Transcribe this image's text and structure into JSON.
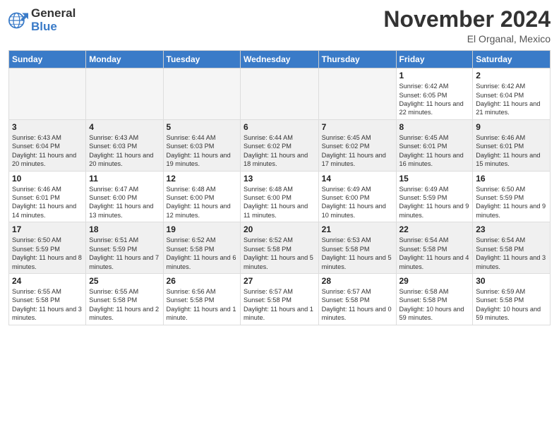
{
  "header": {
    "logo_general": "General",
    "logo_blue": "Blue",
    "month_title": "November 2024",
    "location": "El Organal, Mexico"
  },
  "days_of_week": [
    "Sunday",
    "Monday",
    "Tuesday",
    "Wednesday",
    "Thursday",
    "Friday",
    "Saturday"
  ],
  "weeks": [
    [
      {
        "day": "",
        "empty": true
      },
      {
        "day": "",
        "empty": true
      },
      {
        "day": "",
        "empty": true
      },
      {
        "day": "",
        "empty": true
      },
      {
        "day": "",
        "empty": true
      },
      {
        "day": "1",
        "sunrise": "Sunrise: 6:42 AM",
        "sunset": "Sunset: 6:05 PM",
        "daylight": "Daylight: 11 hours and 22 minutes."
      },
      {
        "day": "2",
        "sunrise": "Sunrise: 6:42 AM",
        "sunset": "Sunset: 6:04 PM",
        "daylight": "Daylight: 11 hours and 21 minutes."
      }
    ],
    [
      {
        "day": "3",
        "sunrise": "Sunrise: 6:43 AM",
        "sunset": "Sunset: 6:04 PM",
        "daylight": "Daylight: 11 hours and 20 minutes."
      },
      {
        "day": "4",
        "sunrise": "Sunrise: 6:43 AM",
        "sunset": "Sunset: 6:03 PM",
        "daylight": "Daylight: 11 hours and 20 minutes."
      },
      {
        "day": "5",
        "sunrise": "Sunrise: 6:44 AM",
        "sunset": "Sunset: 6:03 PM",
        "daylight": "Daylight: 11 hours and 19 minutes."
      },
      {
        "day": "6",
        "sunrise": "Sunrise: 6:44 AM",
        "sunset": "Sunset: 6:02 PM",
        "daylight": "Daylight: 11 hours and 18 minutes."
      },
      {
        "day": "7",
        "sunrise": "Sunrise: 6:45 AM",
        "sunset": "Sunset: 6:02 PM",
        "daylight": "Daylight: 11 hours and 17 minutes."
      },
      {
        "day": "8",
        "sunrise": "Sunrise: 6:45 AM",
        "sunset": "Sunset: 6:01 PM",
        "daylight": "Daylight: 11 hours and 16 minutes."
      },
      {
        "day": "9",
        "sunrise": "Sunrise: 6:46 AM",
        "sunset": "Sunset: 6:01 PM",
        "daylight": "Daylight: 11 hours and 15 minutes."
      }
    ],
    [
      {
        "day": "10",
        "sunrise": "Sunrise: 6:46 AM",
        "sunset": "Sunset: 6:01 PM",
        "daylight": "Daylight: 11 hours and 14 minutes."
      },
      {
        "day": "11",
        "sunrise": "Sunrise: 6:47 AM",
        "sunset": "Sunset: 6:00 PM",
        "daylight": "Daylight: 11 hours and 13 minutes."
      },
      {
        "day": "12",
        "sunrise": "Sunrise: 6:48 AM",
        "sunset": "Sunset: 6:00 PM",
        "daylight": "Daylight: 11 hours and 12 minutes."
      },
      {
        "day": "13",
        "sunrise": "Sunrise: 6:48 AM",
        "sunset": "Sunset: 6:00 PM",
        "daylight": "Daylight: 11 hours and 11 minutes."
      },
      {
        "day": "14",
        "sunrise": "Sunrise: 6:49 AM",
        "sunset": "Sunset: 6:00 PM",
        "daylight": "Daylight: 11 hours and 10 minutes."
      },
      {
        "day": "15",
        "sunrise": "Sunrise: 6:49 AM",
        "sunset": "Sunset: 5:59 PM",
        "daylight": "Daylight: 11 hours and 9 minutes."
      },
      {
        "day": "16",
        "sunrise": "Sunrise: 6:50 AM",
        "sunset": "Sunset: 5:59 PM",
        "daylight": "Daylight: 11 hours and 9 minutes."
      }
    ],
    [
      {
        "day": "17",
        "sunrise": "Sunrise: 6:50 AM",
        "sunset": "Sunset: 5:59 PM",
        "daylight": "Daylight: 11 hours and 8 minutes."
      },
      {
        "day": "18",
        "sunrise": "Sunrise: 6:51 AM",
        "sunset": "Sunset: 5:59 PM",
        "daylight": "Daylight: 11 hours and 7 minutes."
      },
      {
        "day": "19",
        "sunrise": "Sunrise: 6:52 AM",
        "sunset": "Sunset: 5:58 PM",
        "daylight": "Daylight: 11 hours and 6 minutes."
      },
      {
        "day": "20",
        "sunrise": "Sunrise: 6:52 AM",
        "sunset": "Sunset: 5:58 PM",
        "daylight": "Daylight: 11 hours and 5 minutes."
      },
      {
        "day": "21",
        "sunrise": "Sunrise: 6:53 AM",
        "sunset": "Sunset: 5:58 PM",
        "daylight": "Daylight: 11 hours and 5 minutes."
      },
      {
        "day": "22",
        "sunrise": "Sunrise: 6:54 AM",
        "sunset": "Sunset: 5:58 PM",
        "daylight": "Daylight: 11 hours and 4 minutes."
      },
      {
        "day": "23",
        "sunrise": "Sunrise: 6:54 AM",
        "sunset": "Sunset: 5:58 PM",
        "daylight": "Daylight: 11 hours and 3 minutes."
      }
    ],
    [
      {
        "day": "24",
        "sunrise": "Sunrise: 6:55 AM",
        "sunset": "Sunset: 5:58 PM",
        "daylight": "Daylight: 11 hours and 3 minutes."
      },
      {
        "day": "25",
        "sunrise": "Sunrise: 6:55 AM",
        "sunset": "Sunset: 5:58 PM",
        "daylight": "Daylight: 11 hours and 2 minutes."
      },
      {
        "day": "26",
        "sunrise": "Sunrise: 6:56 AM",
        "sunset": "Sunset: 5:58 PM",
        "daylight": "Daylight: 11 hours and 1 minute."
      },
      {
        "day": "27",
        "sunrise": "Sunrise: 6:57 AM",
        "sunset": "Sunset: 5:58 PM",
        "daylight": "Daylight: 11 hours and 1 minute."
      },
      {
        "day": "28",
        "sunrise": "Sunrise: 6:57 AM",
        "sunset": "Sunset: 5:58 PM",
        "daylight": "Daylight: 11 hours and 0 minutes."
      },
      {
        "day": "29",
        "sunrise": "Sunrise: 6:58 AM",
        "sunset": "Sunset: 5:58 PM",
        "daylight": "Daylight: 10 hours and 59 minutes."
      },
      {
        "day": "30",
        "sunrise": "Sunrise: 6:59 AM",
        "sunset": "Sunset: 5:58 PM",
        "daylight": "Daylight: 10 hours and 59 minutes."
      }
    ]
  ]
}
